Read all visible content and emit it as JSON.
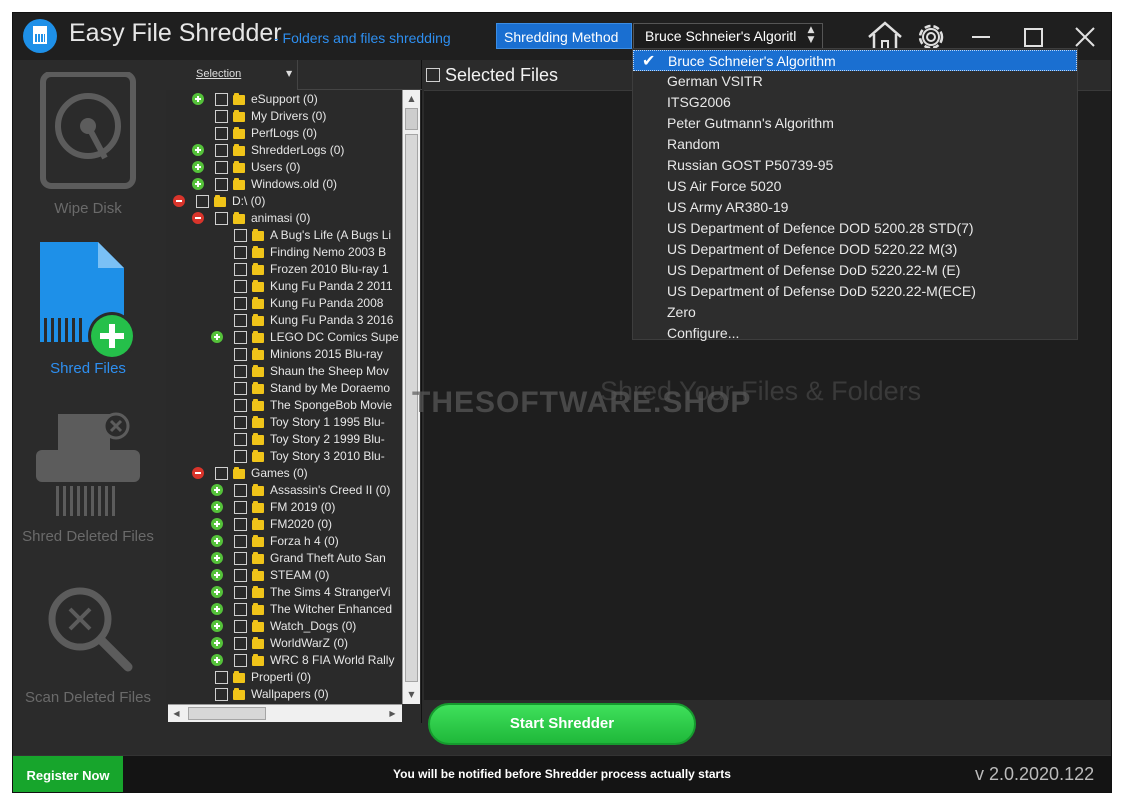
{
  "app": {
    "title": "Easy File Shredder",
    "subtitle": "- Folders and files shredding",
    "accent": "#2e8ff0"
  },
  "method": {
    "label": "Shredding Method",
    "selected": "Bruce Schneier's Algorithm",
    "selected_display": "Bruce Schneier's Algoritl",
    "options": [
      "Bruce Schneier's Algorithm",
      "German VSITR",
      "ITSG2006",
      "Peter Gutmann's Algorithm",
      "Random",
      "Russian GOST P50739-95",
      "US Air Force 5020",
      "US Army AR380-19",
      "US Department of Defence DOD 5200.28 STD(7)",
      "US Department of Defence DOD 5220.22 M(3)",
      "US Department of Defense DoD 5220.22-M (E)",
      "US Department of Defense DoD 5220.22-M(ECE)",
      "Zero",
      "Configure..."
    ]
  },
  "titlebar_icons": [
    "home-icon",
    "gear-icon",
    "minimize-icon",
    "maximize-icon",
    "close-icon"
  ],
  "sidebar": {
    "items": [
      {
        "label": "Wipe Disk",
        "icon": "hard-disk-icon",
        "active": false
      },
      {
        "label": "Shred Files",
        "icon": "shred-file-add-icon",
        "active": true
      },
      {
        "label": "Shred Deleted Files",
        "icon": "shredder-icon",
        "active": false
      },
      {
        "label": "Scan Deleted Files",
        "icon": "magnifier-x-icon",
        "active": false
      }
    ]
  },
  "tree": {
    "header": "Selection",
    "rows": [
      {
        "label": "eSupport (0)",
        "level": 1,
        "exp": "plus"
      },
      {
        "label": "My Drivers (0)",
        "level": 1,
        "exp": ""
      },
      {
        "label": "PerfLogs (0)",
        "level": 1,
        "exp": ""
      },
      {
        "label": "ShredderLogs (0)",
        "level": 1,
        "exp": "plus"
      },
      {
        "label": "Users (0)",
        "level": 1,
        "exp": "plus"
      },
      {
        "label": "Windows.old (0)",
        "level": 1,
        "exp": "plus"
      },
      {
        "label": "D:\\ (0)",
        "level": 0,
        "exp": "minus"
      },
      {
        "label": "animasi (0)",
        "level": 1,
        "exp": "minus"
      },
      {
        "label": "A Bug's Life (A Bugs Li",
        "level": 2,
        "exp": ""
      },
      {
        "label": "Finding Nemo 2003  B",
        "level": 2,
        "exp": ""
      },
      {
        "label": "Frozen 2010  Blu-ray 1",
        "level": 2,
        "exp": ""
      },
      {
        "label": "Kung Fu Panda 2 2011",
        "level": 2,
        "exp": ""
      },
      {
        "label": "Kung Fu Panda 2008",
        "level": 2,
        "exp": ""
      },
      {
        "label": "Kung Fu Panda 3 2016",
        "level": 2,
        "exp": ""
      },
      {
        "label": "LEGO DC Comics Supe",
        "level": 2,
        "exp": "plus"
      },
      {
        "label": "Minions 2015  Blu-ray",
        "level": 2,
        "exp": ""
      },
      {
        "label": "Shaun the Sheep Mov",
        "level": 2,
        "exp": ""
      },
      {
        "label": "Stand by Me Doraemo",
        "level": 2,
        "exp": ""
      },
      {
        "label": "The SpongeBob Movie",
        "level": 2,
        "exp": ""
      },
      {
        "label": "Toy Story 1 1995  Blu-",
        "level": 2,
        "exp": ""
      },
      {
        "label": "Toy Story 2 1999  Blu-",
        "level": 2,
        "exp": ""
      },
      {
        "label": "Toy Story 3 2010  Blu-",
        "level": 2,
        "exp": ""
      },
      {
        "label": "Games (0)",
        "level": 1,
        "exp": "minus"
      },
      {
        "label": "Assassin's Creed II (0)",
        "level": 2,
        "exp": "plus"
      },
      {
        "label": "FM 2019 (0)",
        "level": 2,
        "exp": "plus"
      },
      {
        "label": "FM2020 (0)",
        "level": 2,
        "exp": "plus"
      },
      {
        "label": "Forza h 4 (0)",
        "level": 2,
        "exp": "plus"
      },
      {
        "label": "Grand Theft Auto San",
        "level": 2,
        "exp": "plus"
      },
      {
        "label": "STEAM (0)",
        "level": 2,
        "exp": "plus"
      },
      {
        "label": "The Sims 4 StrangerVi",
        "level": 2,
        "exp": "plus"
      },
      {
        "label": "The Witcher Enhanced",
        "level": 2,
        "exp": "plus"
      },
      {
        "label": "Watch_Dogs (0)",
        "level": 2,
        "exp": "plus"
      },
      {
        "label": "WorldWarZ (0)",
        "level": 2,
        "exp": "plus"
      },
      {
        "label": "WRC 8 FIA World Rally",
        "level": 2,
        "exp": "plus"
      },
      {
        "label": "Properti (0)",
        "level": 1,
        "exp": ""
      },
      {
        "label": "Wallpapers (0)",
        "level": 1,
        "exp": ""
      }
    ]
  },
  "main": {
    "selected_files_label": "Selected Files",
    "empty_hint": "Shred Your Files & Folders",
    "watermark": "THESOFTWARE.SHOP",
    "start_button": "Start Shredder"
  },
  "footer": {
    "register": "Register Now",
    "notice": "You will be notified before Shredder process actually starts",
    "version": "v 2.0.2020.122"
  }
}
